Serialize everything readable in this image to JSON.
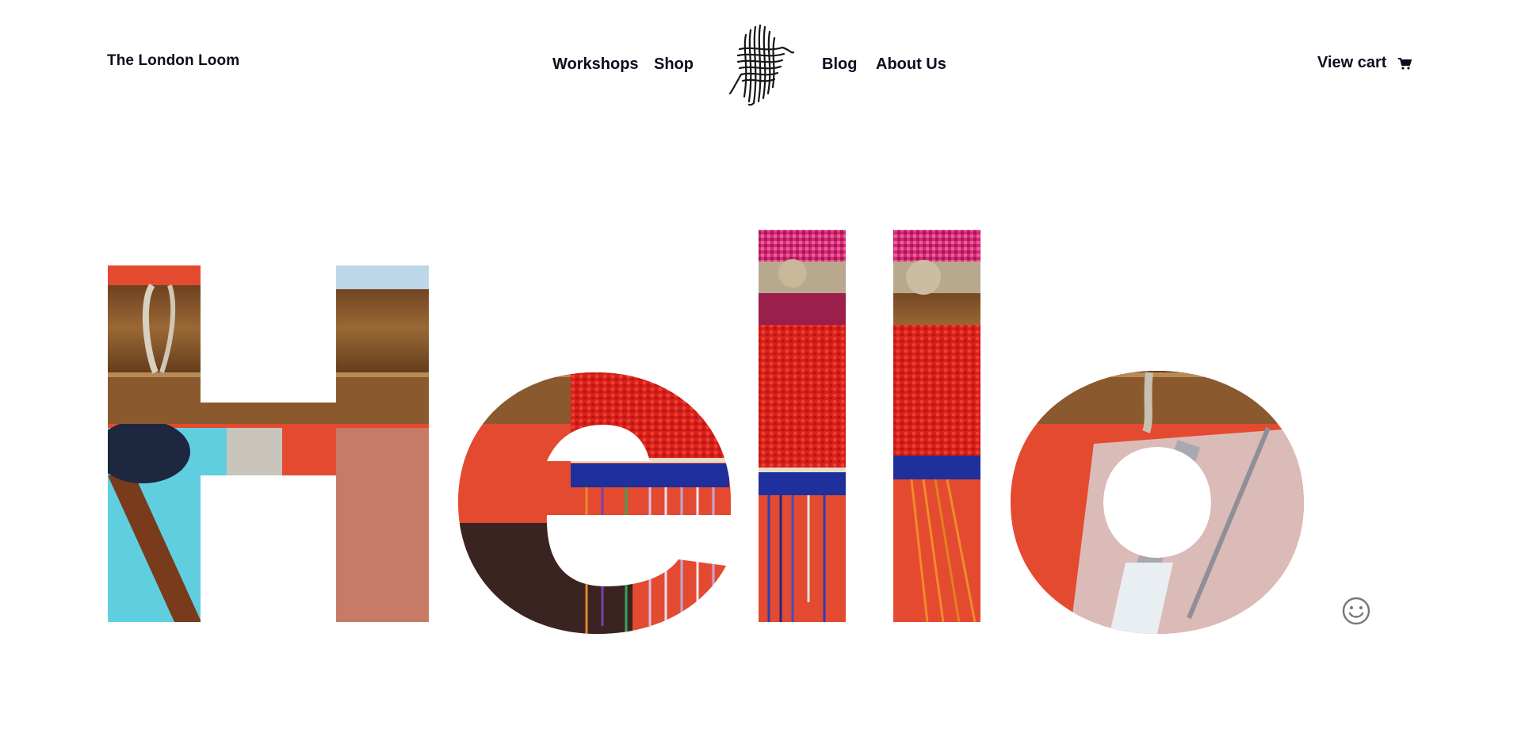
{
  "header": {
    "site_title": "The London Loom",
    "nav": {
      "workshops": "Workshops",
      "shop": "Shop",
      "blog": "Blog",
      "about": "About Us"
    },
    "logo": "woven-yarn-logo",
    "cart": {
      "label": "View cart",
      "icon": "cart-icon"
    }
  },
  "hero": {
    "headline": "Hello",
    "image_subject": "weaving loom with red, blue and pink yarn",
    "reaction_icon": "smiley-icon"
  },
  "colors": {
    "text": "#0d0d1e",
    "background": "#ffffff",
    "yarn_red": "#e2231f",
    "yarn_blue": "#1f2f9c",
    "wood": "#8a5a2e",
    "sky": "#5fd0e0",
    "pink": "#e8337a"
  }
}
